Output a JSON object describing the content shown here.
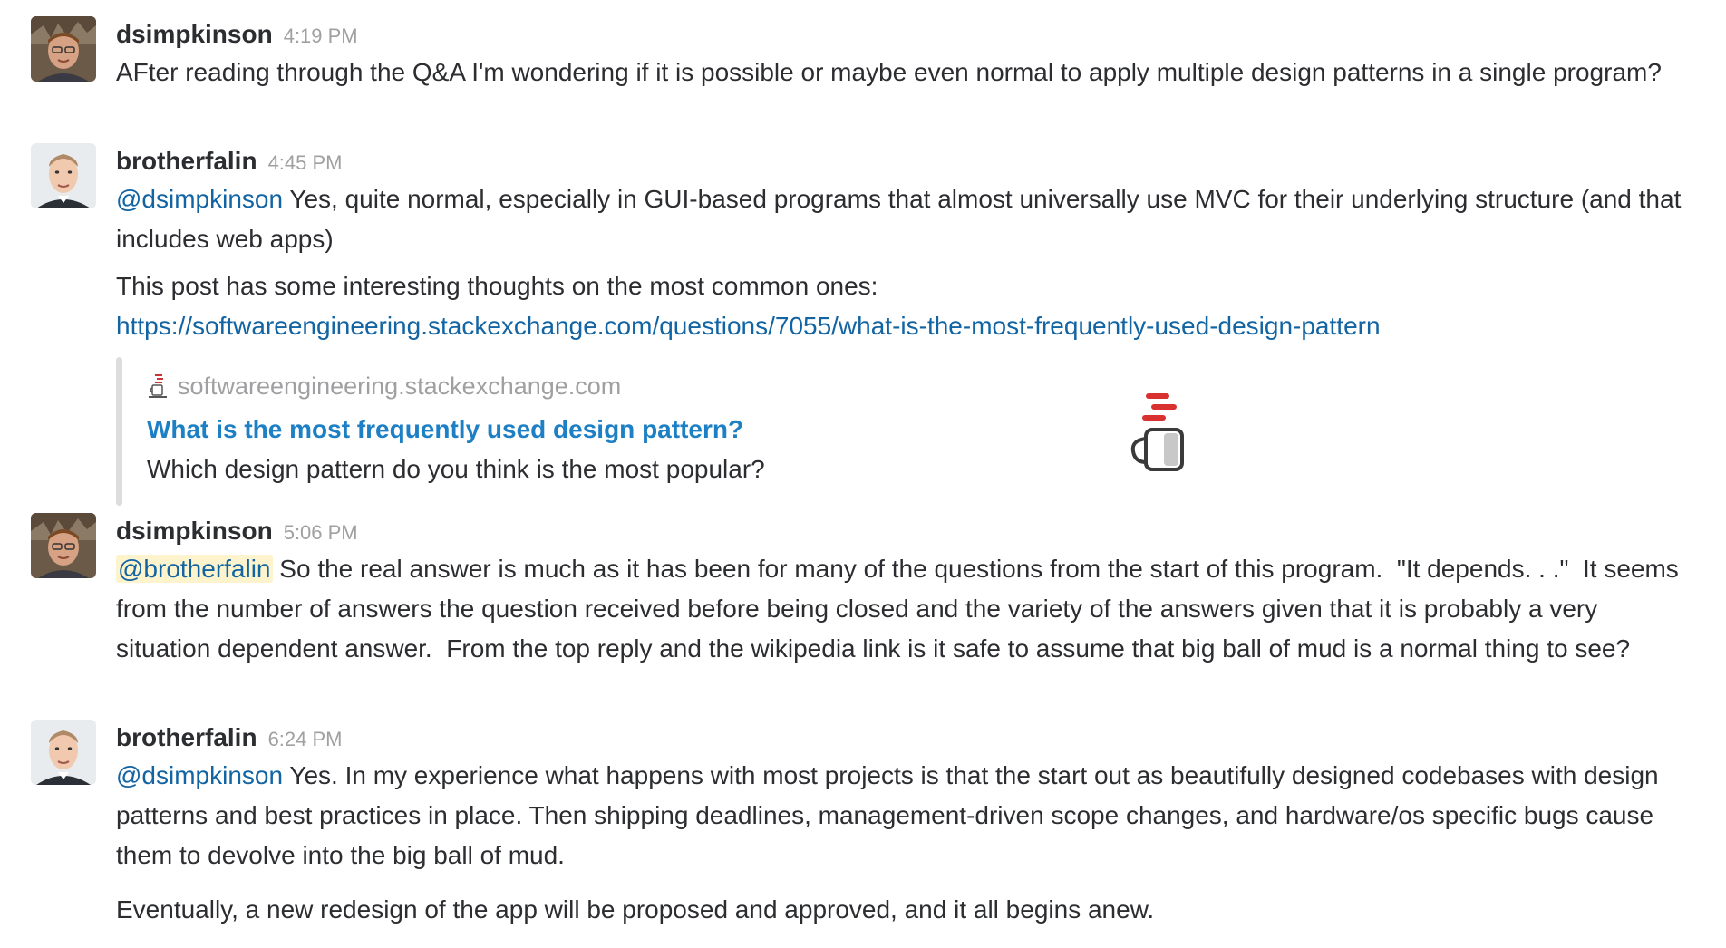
{
  "messages": [
    {
      "username": "dsimpkinson",
      "time": "4:19 PM",
      "lines": [
        "AFter reading through the Q&A I'm wondering if it is possible or maybe even normal to apply multiple design patterns in a single program?"
      ]
    },
    {
      "username": "brotherfalin",
      "time": "4:45 PM",
      "mention": "@dsimpkinson",
      "line1_rest": " Yes, quite normal, especially in GUI-based programs that almost universally use MVC for their underlying structure (and that includes web apps)",
      "line2": "This post has some interesting thoughts on the most common ones:",
      "link": "https://softwareengineering.stackexchange.com/questions/7055/what-is-the-most-frequently-used-design-pattern",
      "attachment": {
        "service": "softwareengineering.stackexchange.com",
        "title": "What is the most frequently used design pattern?",
        "text": "Which design pattern do you think is the most popular?",
        "favicon_icon": "stackexchange-icon",
        "thumb_icon": "coffee-mug-icon"
      }
    },
    {
      "username": "dsimpkinson",
      "time": "5:06 PM",
      "mention": "@brotherfalin",
      "text_rest": " So the real answer is much as it has been for many of the questions from the start of this program.  \"It depends. . .\"  It seems from the number of answers the question received before being closed and the variety of the answers given that it is probably a very situation dependent answer.  From the top reply and the wikipedia link is it safe to assume that big ball of mud is a normal thing to see?"
    },
    {
      "username": "brotherfalin",
      "time": "6:24 PM",
      "mention": "@dsimpkinson",
      "text_rest": " Yes. In my experience what happens with most projects is that the start out as beautifully designed codebases with design patterns and best practices in place. Then shipping deadlines, management-driven scope changes, and hardware/os specific bugs cause them to devolve into the big ball of mud.",
      "line2": "Eventually, a new redesign of the app will be proposed and approved, and it all begins anew."
    }
  ],
  "colors": {
    "link": "#1264a3",
    "attachment_title": "#1d7fc4",
    "timestamp": "#a0a0a2",
    "mention_highlight": "#fdf3cc",
    "text": "#2c2d30"
  }
}
